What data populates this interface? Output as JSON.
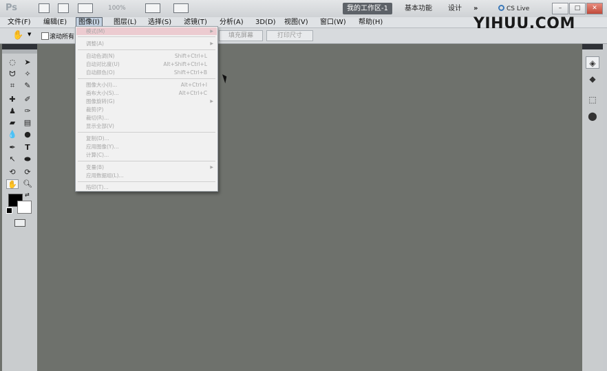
{
  "app": {
    "logo_text": "Ps",
    "zoom": "100%"
  },
  "workspace": {
    "active": "我的工作区-1",
    "basic": "基本功能",
    "design": "设计",
    "more": "»",
    "cs_live": "CS Live"
  },
  "window_buttons": {
    "minimize": "–",
    "restore": "□",
    "close": "✕"
  },
  "menubar": [
    {
      "label": "文件(F)"
    },
    {
      "label": "编辑(E)"
    },
    {
      "label": "图像(I)"
    },
    {
      "label": "图层(L)"
    },
    {
      "label": "选择(S)"
    },
    {
      "label": "滤镜(T)"
    },
    {
      "label": "分析(A)"
    },
    {
      "label": "3D(D)"
    },
    {
      "label": "视图(V)"
    },
    {
      "label": "窗口(W)"
    },
    {
      "label": "帮助(H)"
    }
  ],
  "watermark": "YIHUU.COM",
  "options": {
    "scroll_all": "滚动所有",
    "fill_screen": "填充屏幕",
    "print_size": "打印尺寸"
  },
  "image_menu": [
    {
      "label": "模式(M)",
      "shortcut": "",
      "submenu": true
    },
    {
      "label": "调整(A)",
      "shortcut": "",
      "submenu": true
    },
    {
      "label": "自动色调(N)",
      "shortcut": "Shift+Ctrl+L"
    },
    {
      "label": "自动对比度(U)",
      "shortcut": "Alt+Shift+Ctrl+L"
    },
    {
      "label": "自动颜色(O)",
      "shortcut": "Shift+Ctrl+B"
    },
    {
      "label": "图像大小(I)...",
      "shortcut": "Alt+Ctrl+I"
    },
    {
      "label": "画布大小(S)...",
      "shortcut": "Alt+Ctrl+C"
    },
    {
      "label": "图像旋转(G)",
      "shortcut": "",
      "submenu": true
    },
    {
      "label": "裁剪(P)",
      "shortcut": ""
    },
    {
      "label": "裁切(R)...",
      "shortcut": ""
    },
    {
      "label": "显示全部(V)",
      "shortcut": ""
    },
    {
      "label": "复制(D)...",
      "shortcut": ""
    },
    {
      "label": "应用图像(Y)...",
      "shortcut": ""
    },
    {
      "label": "计算(C)...",
      "shortcut": ""
    },
    {
      "label": "变量(B)",
      "shortcut": "",
      "submenu": true
    },
    {
      "label": "应用数据组(L)...",
      "shortcut": ""
    },
    {
      "label": "陷印(T)...",
      "shortcut": ""
    }
  ]
}
